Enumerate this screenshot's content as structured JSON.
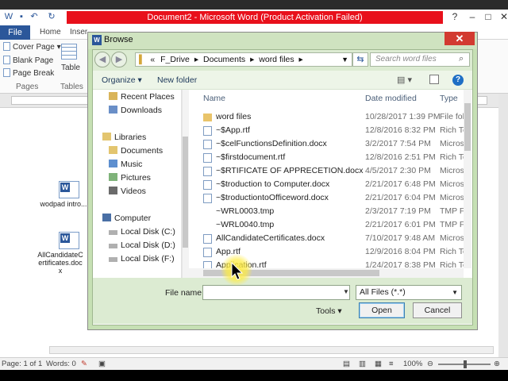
{
  "word": {
    "title": "Document2 - Microsoft Word (Product Activation Failed)",
    "tabs": [
      "File",
      "Home",
      "Inser"
    ],
    "ribbon": {
      "cover_page": "Cover Page",
      "blank_page": "Blank Page",
      "page_break": "Page Break",
      "pages_group": "Pages",
      "table": "Table",
      "tables_group": "Tables"
    },
    "desktop_files": [
      {
        "label": "wodpad intro..."
      },
      {
        "label": "AllCandidateCertificates.docx"
      }
    ],
    "status": {
      "page": "Page: 1 of 1",
      "words": "Words: 0",
      "zoom": "100%"
    }
  },
  "dialog": {
    "title": "Browse",
    "close_label": "✕",
    "address": {
      "prefix": "«",
      "crumbs": [
        "F_Drive",
        "Documents",
        "word files"
      ]
    },
    "search_placeholder": "Search word files",
    "toolbar": {
      "organize": "Organize ▾",
      "new_folder": "New folder"
    },
    "nav": {
      "recent_places": "Recent Places",
      "downloads": "Downloads",
      "libraries": "Libraries",
      "documents": "Documents",
      "music": "Music",
      "pictures": "Pictures",
      "videos": "Videos",
      "computer": "Computer",
      "disk_c": "Local Disk (C:)",
      "disk_d": "Local Disk (D:)",
      "disk_f": "Local Disk (F:)"
    },
    "columns": {
      "name": "Name",
      "date": "Date modified",
      "type": "Type"
    },
    "files": [
      {
        "name": "word files",
        "date": "10/28/2017 1:39 PM",
        "type": "File fol",
        "kind": "folder"
      },
      {
        "name": "~$App.rtf",
        "date": "12/8/2016 8:32 PM",
        "type": "Rich Te",
        "kind": "doc"
      },
      {
        "name": "~$celFunctionsDefinition.docx",
        "date": "3/2/2017 7:54 PM",
        "type": "Micros",
        "kind": "doc"
      },
      {
        "name": "~$firstdocument.rtf",
        "date": "12/8/2016 2:51 PM",
        "type": "Rich Te",
        "kind": "doc"
      },
      {
        "name": "~$RTIFICATE OF APPRECETION.docx",
        "date": "4/5/2017 2:30 PM",
        "type": "Micros",
        "kind": "doc"
      },
      {
        "name": "~$troduction to Computer.docx",
        "date": "2/21/2017 6:48 PM",
        "type": "Micros",
        "kind": "doc"
      },
      {
        "name": "~$troductiontoOfficeword.docx",
        "date": "2/21/2017 6:04 PM",
        "type": "Micros",
        "kind": "doc"
      },
      {
        "name": "~WRL0003.tmp",
        "date": "2/3/2017 7:19 PM",
        "type": "TMP Fi",
        "kind": "tmp"
      },
      {
        "name": "~WRL0040.tmp",
        "date": "2/21/2017 6:01 PM",
        "type": "TMP Fi",
        "kind": "tmp"
      },
      {
        "name": "AllCandidateCertificates.docx",
        "date": "7/10/2017 9:48 AM",
        "type": "Micros",
        "kind": "doc"
      },
      {
        "name": "App.rtf",
        "date": "12/9/2016 8:04 PM",
        "type": "Rich Te",
        "kind": "doc"
      },
      {
        "name": "Application.rtf",
        "date": "1/24/2017 8:38 PM",
        "type": "Rich Te",
        "kind": "doc"
      }
    ],
    "file_name_label": "File name:",
    "file_name_value": "",
    "filter": "All Files (*.*)",
    "tools": "Tools ▾",
    "open": "Open",
    "cancel": "Cancel"
  },
  "colors": {
    "accent": "#2b579a",
    "title_red": "#e8101b",
    "dialog_frame": "#c6e0b4"
  }
}
